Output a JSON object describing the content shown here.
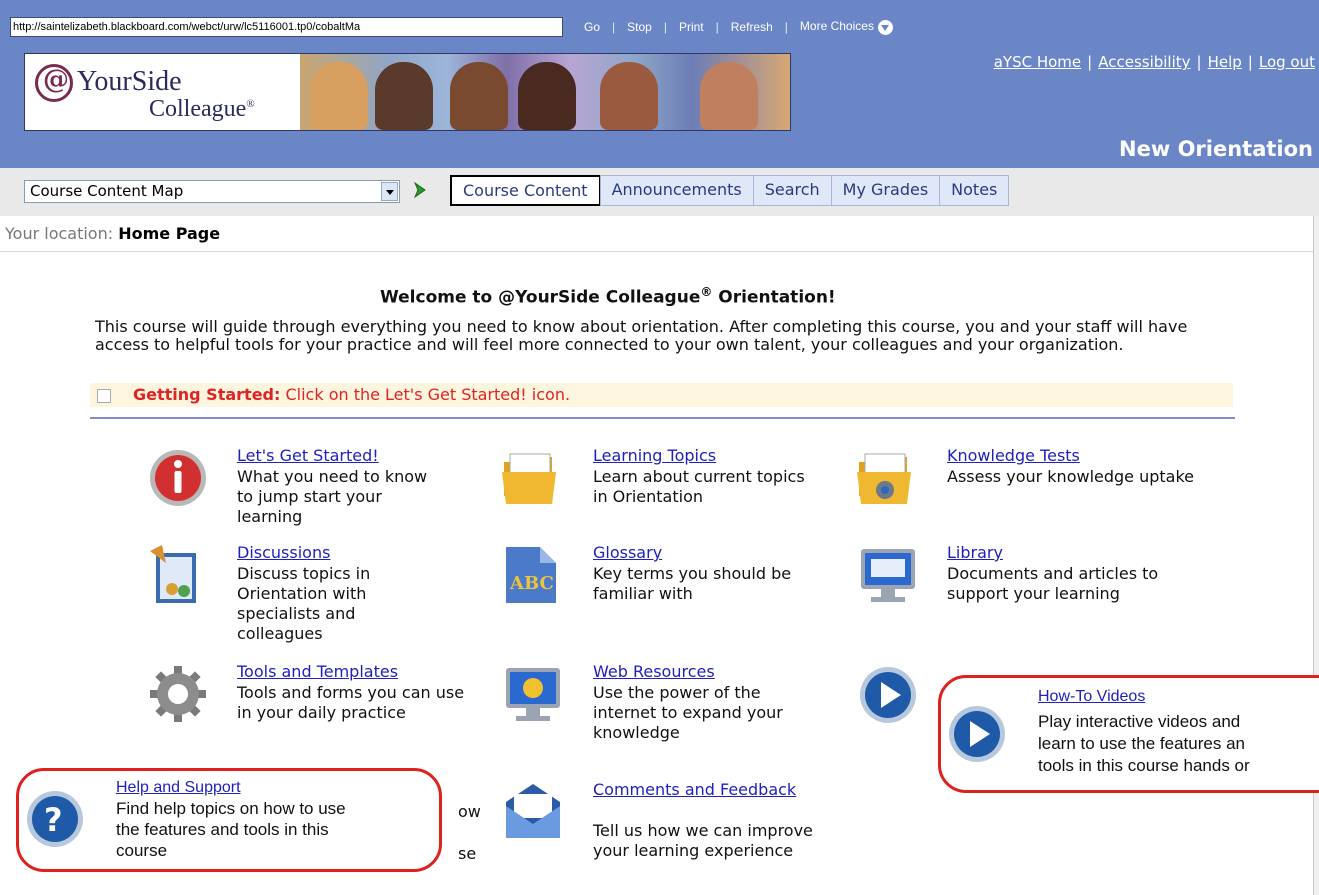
{
  "browser": {
    "url": "http://saintelizabeth.blackboard.com/webct/urw/lc5116001.tp0/cobaltMa",
    "nav": [
      "Go",
      "Stop",
      "Print",
      "Refresh",
      "More Choices"
    ]
  },
  "header": {
    "logo_line1": "YourSide",
    "logo_line2": "Colleague",
    "logo_reg": "®",
    "links": [
      "aYSC Home",
      "Accessibility",
      "Help",
      "Log out"
    ],
    "course_title": "New Orientation"
  },
  "toolbar": {
    "select_value": "Course Content Map",
    "tabs": [
      "Course Content",
      "Announcements",
      "Search",
      "My Grades",
      "Notes"
    ]
  },
  "location": {
    "label": "Your location:",
    "value": "Home Page"
  },
  "main": {
    "welcome_pre": "Welcome to @YourSide Colleague",
    "welcome_reg": "®",
    "welcome_post": " Orientation!",
    "intro": "This course will guide through everything you need to know about orientation. After completing this course, you and your staff will have access to helpful tools for your practice and will feel more connected to your own talent, your colleagues and your organization.",
    "getting_started_label": "Getting Started:",
    "getting_started_text": " Click on the Let's Get Started! icon.",
    "items": [
      {
        "title": "Let's Get Started!",
        "desc": "What you need to know to jump start your learning",
        "icon": "info-icon"
      },
      {
        "title": "Learning Topics",
        "desc": "Learn about current topics in Orientation",
        "icon": "folder-icon"
      },
      {
        "title": "Knowledge Tests",
        "desc": "Assess your knowledge uptake",
        "icon": "test-folder-icon"
      },
      {
        "title": "Discussions",
        "desc": "Discuss topics in Orientation with specialists and colleagues",
        "icon": "discussion-icon"
      },
      {
        "title": "Glossary",
        "desc": "Key terms you should be familiar with",
        "icon": "glossary-abc-icon"
      },
      {
        "title": "Library",
        "desc": "Documents and articles to support your learning",
        "icon": "library-monitor-icon"
      },
      {
        "title": "Tools and Templates",
        "desc": "Tools and forms you can use in your daily practice",
        "icon": "gear-icon"
      },
      {
        "title": "Web Resources",
        "desc": "Use the power of the internet to expand your knowledge",
        "icon": "web-monitor-icon"
      },
      {
        "title": "Comments and Feedback",
        "desc": "Tell us how we can improve your learning experience",
        "icon": "envelope-icon"
      }
    ],
    "partial_text": [
      "ow",
      "se"
    ]
  },
  "callouts": {
    "help": {
      "title": "Help and Support",
      "lines": [
        "Find help topics on how to use",
        "the features and tools in this",
        "course"
      ],
      "icon": "help-question-icon"
    },
    "videos": {
      "title": "How-To Videos",
      "lines": [
        "Play interactive videos and",
        "learn to use the features an",
        "tools in this course hands or"
      ],
      "icon": "play-icon"
    }
  },
  "colors": {
    "banner": "#6b86c6",
    "link": "#2020c0",
    "callout_border": "#e01f1f",
    "getting_started": "#e02424"
  }
}
